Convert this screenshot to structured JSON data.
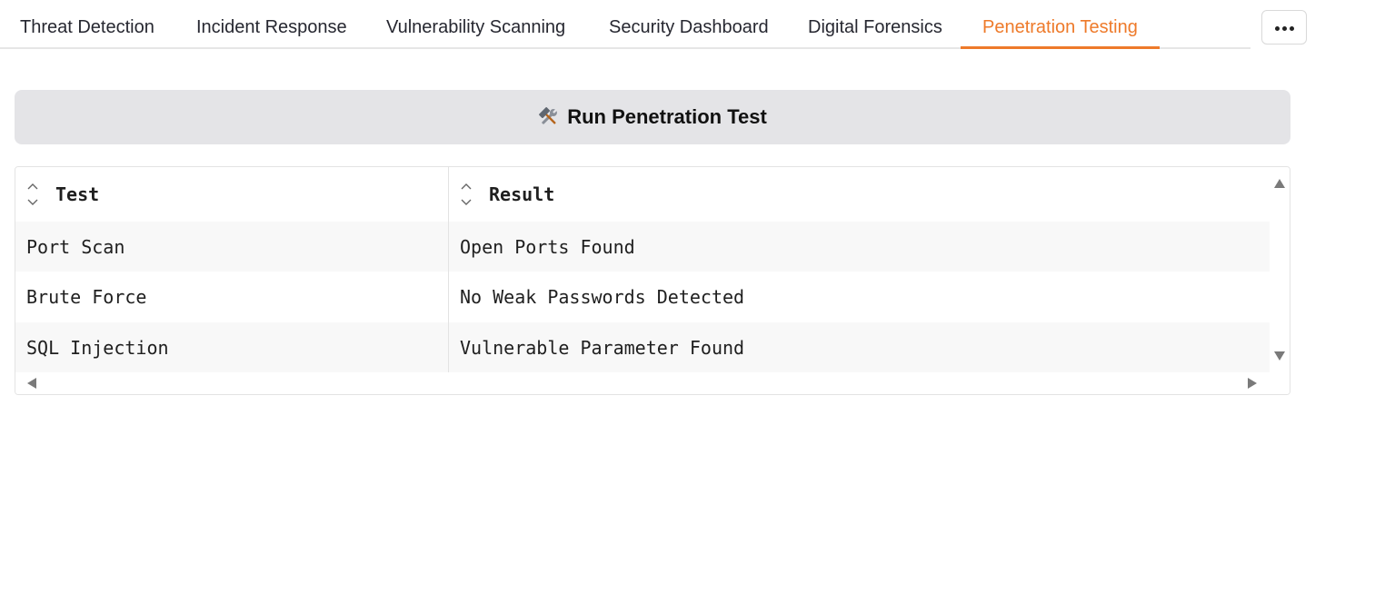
{
  "tabs": [
    {
      "label": "Threat Detection",
      "active": false
    },
    {
      "label": "Incident Response",
      "active": false
    },
    {
      "label": "Vulnerability Scanning",
      "active": false
    },
    {
      "label": "Security Dashboard",
      "active": false
    },
    {
      "label": "Digital Forensics",
      "active": false
    },
    {
      "label": "Penetration Testing",
      "active": true
    }
  ],
  "overflow_menu": {
    "icon": "more-horizontal-icon"
  },
  "run_button": {
    "label": "Run Penetration Test",
    "icon": "hammer-and-wrench-icon"
  },
  "table": {
    "columns": [
      "Test",
      "Result"
    ],
    "rows": [
      [
        "Port Scan",
        "Open Ports Found"
      ],
      [
        "Brute Force",
        "No Weak Passwords Detected"
      ],
      [
        "SQL Injection",
        "Vulnerable Parameter Found"
      ]
    ]
  },
  "colors": {
    "accent": "#ee7a2a",
    "button_bg": "#e4e4e7",
    "row_stripe": "#f8f8f8"
  }
}
